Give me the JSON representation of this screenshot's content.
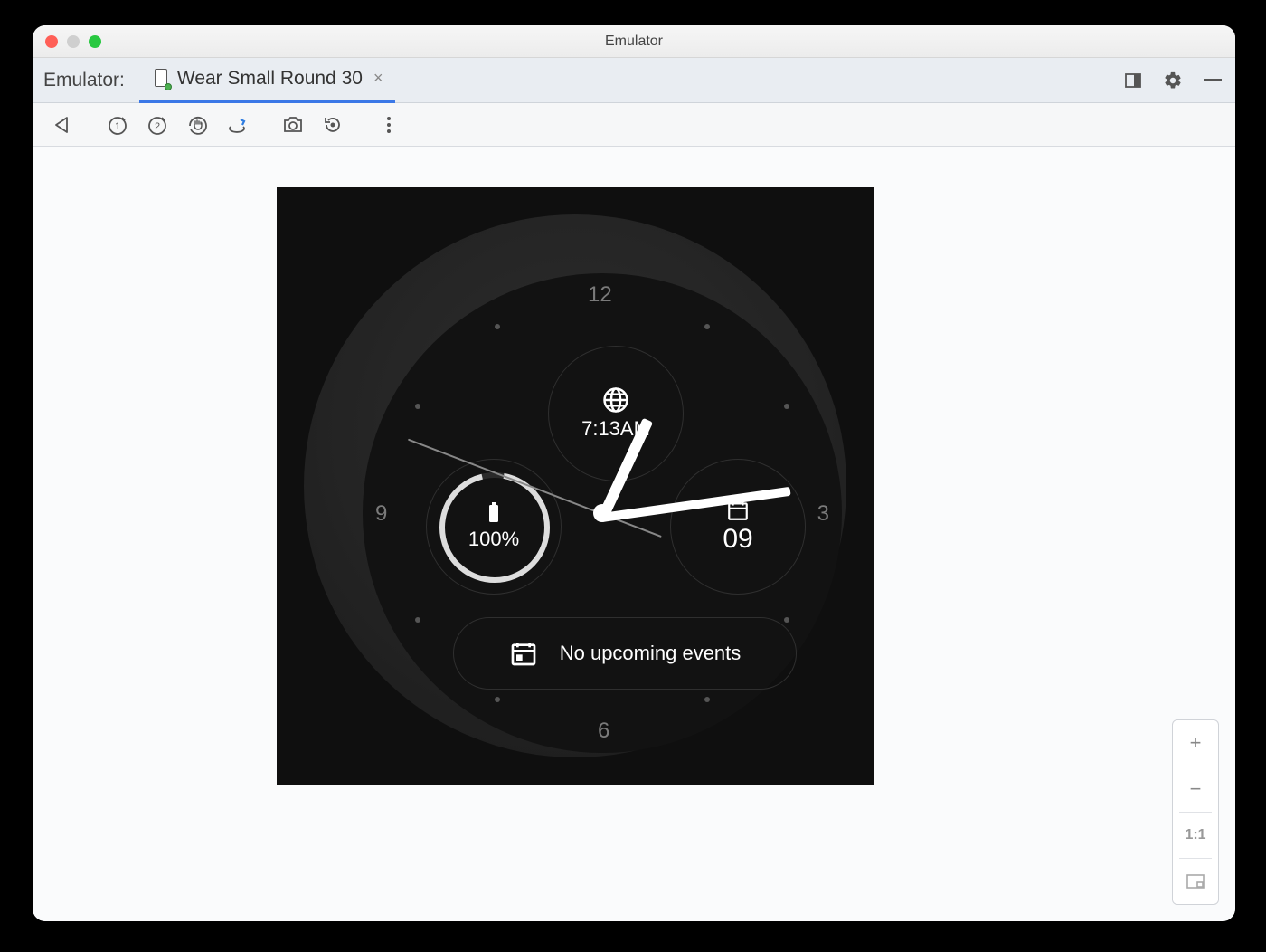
{
  "window": {
    "title": "Emulator"
  },
  "tabbar": {
    "label": "Emulator:",
    "tab_name": "Wear Small Round 30"
  },
  "watch": {
    "hours": {
      "n12": "12",
      "n3": "3",
      "n6": "6",
      "n9": "9"
    },
    "world_time": "7:13AM",
    "battery": "100%",
    "date": "09",
    "events": "No upcoming events"
  },
  "zoom": {
    "plus": "+",
    "minus": "−",
    "ratio": "1:1"
  }
}
